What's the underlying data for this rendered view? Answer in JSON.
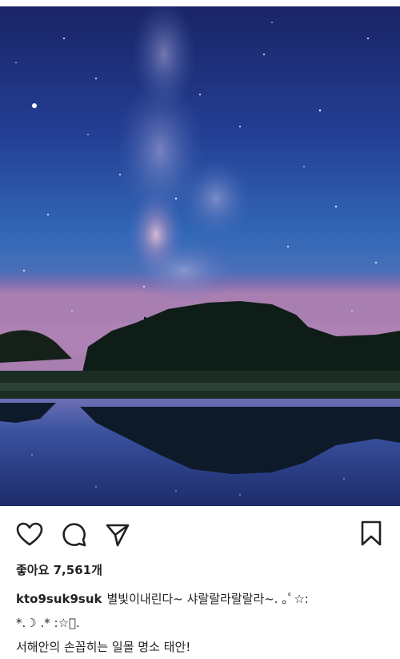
{
  "post": {
    "image_icon": "night-sky-milky-way-photo",
    "actions": {
      "like_icon": "heart-icon",
      "comment_icon": "comment-bubble-icon",
      "share_icon": "send-paper-plane-icon",
      "save_icon": "bookmark-icon"
    },
    "likes_text": "좋아요 7,561개",
    "caption": {
      "username": "kto9suk9suk",
      "line1": "별빛이내린다~ 샤랄랄라랄랄라~. ｡ﾟ☆:",
      "line2": "*.☽ .* :☆ﾟ.",
      "line3": "서해안의 손꼽히는 일몰 명소 태안!"
    }
  },
  "colors": {
    "sky_top": "#1b2a6b",
    "sky_mid": "#2f63b8",
    "horizon_pink": "#b07ab0",
    "text": "#222222"
  }
}
